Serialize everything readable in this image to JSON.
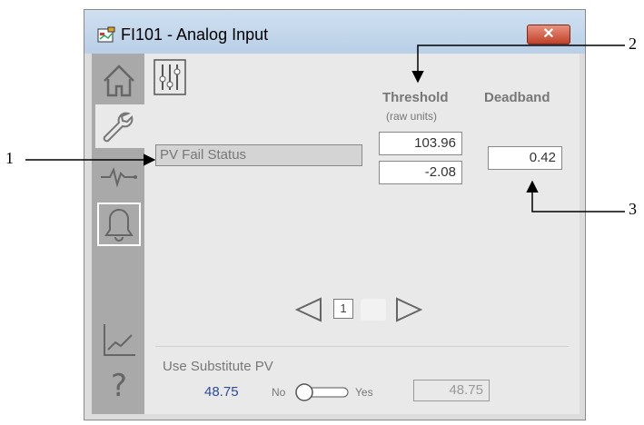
{
  "window": {
    "title": "FI101 - Analog Input",
    "close_label": "✕"
  },
  "sidebar": {
    "items": [
      {
        "name": "home",
        "icon": "home-icon"
      },
      {
        "name": "maintenance",
        "icon": "wrench-icon"
      },
      {
        "name": "trend",
        "icon": "pulse-icon"
      },
      {
        "name": "alarm",
        "icon": "bell-icon"
      },
      {
        "name": "trends",
        "icon": "chart-line-icon"
      },
      {
        "name": "help",
        "icon": "question-icon",
        "label": "?"
      }
    ]
  },
  "content": {
    "settings_icon": "sliders-icon",
    "threshold_header": "Threshold",
    "threshold_sub": "(raw units)",
    "deadband_header": "Deadband",
    "pv_fail_label": "PV Fail Status",
    "threshold_high": "103.96",
    "threshold_low": "-2.08",
    "deadband_value": "0.42",
    "page_number": "1",
    "substitute": {
      "label": "Use Substitute PV",
      "current_value": "48.75",
      "no_label": "No",
      "yes_label": "Yes",
      "field_value": "48.75"
    }
  },
  "callouts": [
    "1",
    "2",
    "3"
  ]
}
